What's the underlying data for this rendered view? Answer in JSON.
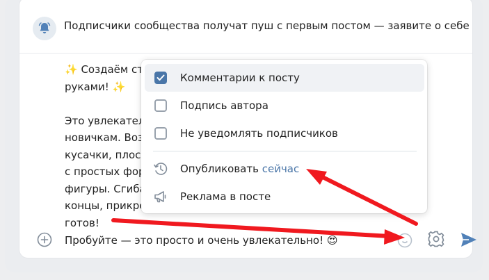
{
  "banner": {
    "text": "Подписчики сообщества получат пуш с первым постом — заявите о себе",
    "icon": "bell-icon"
  },
  "post": {
    "lines": [
      "✨ Создаём сти",
      "руками! ✨",
      "",
      "Это увлекатель",
      "новичкам. Возь",
      "кусачки, плоско",
      "с простых форм",
      "фигуры. Сгибай",
      "концы, прикреп",
      "готов!"
    ],
    "last_line": "Пробуйте — это просто и очень увлекательно! 😍"
  },
  "menu": {
    "items": [
      {
        "label": "Комментарии к посту",
        "checked": true
      },
      {
        "label": "Подпись автора",
        "checked": false
      },
      {
        "label": "Не уведомлять подписчиков",
        "checked": false
      }
    ],
    "publish_label": "Опубликовать",
    "publish_link": "сейчас",
    "ads_label": "Реклама в посте"
  },
  "colors": {
    "accent": "#4a76a8",
    "arrow": "#f0191f"
  }
}
